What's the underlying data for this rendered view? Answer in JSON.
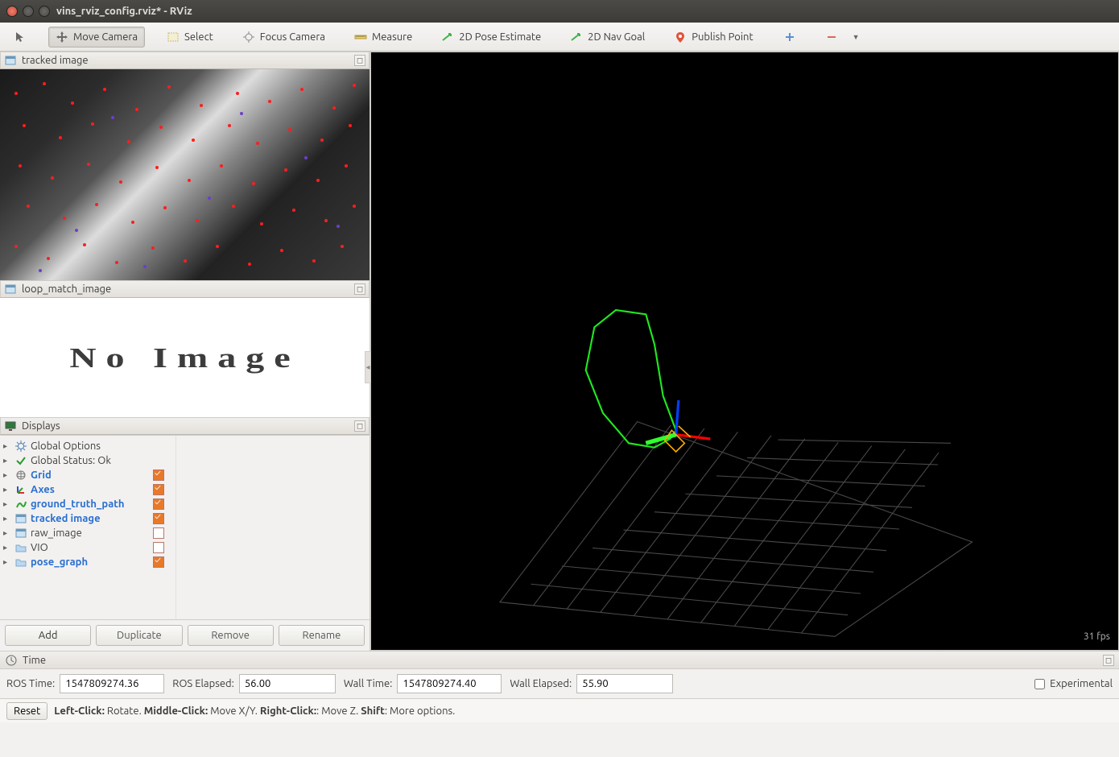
{
  "window_title": "vins_rviz_config.rviz* - RViz",
  "toolbar": {
    "interact": "Interact",
    "move_camera": "Move Camera",
    "select": "Select",
    "focus_camera": "Focus Camera",
    "measure": "Measure",
    "pose_estimate": "2D Pose Estimate",
    "nav_goal": "2D Nav Goal",
    "publish_point": "Publish Point"
  },
  "panels": {
    "tracked_image_title": "tracked image",
    "loop_match_title": "loop_match_image",
    "no_image_text": "No Image",
    "displays_title": "Displays"
  },
  "display_tree": [
    {
      "label": "Global Options",
      "icon": "gear-icon",
      "style": "normal",
      "check": null
    },
    {
      "label": "Global Status: Ok",
      "icon": "check-icon",
      "style": "normal",
      "check": null
    },
    {
      "label": "Grid",
      "icon": "grid-icon",
      "style": "blue",
      "check": "checked"
    },
    {
      "label": "Axes",
      "icon": "axes-icon",
      "style": "blue",
      "check": "checked"
    },
    {
      "label": "ground_truth_path",
      "icon": "path-icon",
      "style": "blue",
      "check": "checked"
    },
    {
      "label": "tracked image",
      "icon": "image-icon",
      "style": "blue",
      "check": "checked"
    },
    {
      "label": "raw_image",
      "icon": "image-icon",
      "style": "normal",
      "check": "unchecked"
    },
    {
      "label": "VIO",
      "icon": "folder-icon",
      "style": "normal",
      "check": "unchecked"
    },
    {
      "label": "pose_graph",
      "icon": "folder-icon",
      "style": "blue",
      "check": "checked"
    }
  ],
  "buttons": {
    "add": "Add",
    "duplicate": "Duplicate",
    "remove": "Remove",
    "rename": "Rename"
  },
  "time_panel": {
    "title": "Time",
    "ros_time_label": "ROS Time:",
    "ros_time_value": "1547809274.36",
    "ros_elapsed_label": "ROS Elapsed:",
    "ros_elapsed_value": "56.00",
    "wall_time_label": "Wall Time:",
    "wall_time_value": "1547809274.40",
    "wall_elapsed_label": "Wall Elapsed:",
    "wall_elapsed_value": "55.90",
    "experimental_label": "Experimental"
  },
  "status": {
    "reset": "Reset",
    "hint_left_b": "Left-Click:",
    "hint_left": " Rotate. ",
    "hint_mid_b": "Middle-Click:",
    "hint_mid": " Move X/Y. ",
    "hint_right_b": "Right-Click:",
    "hint_right": ": Move Z. ",
    "hint_shift_b": "Shift",
    "hint_shift": ": More options."
  },
  "viewport": {
    "fps": "31 fps"
  }
}
